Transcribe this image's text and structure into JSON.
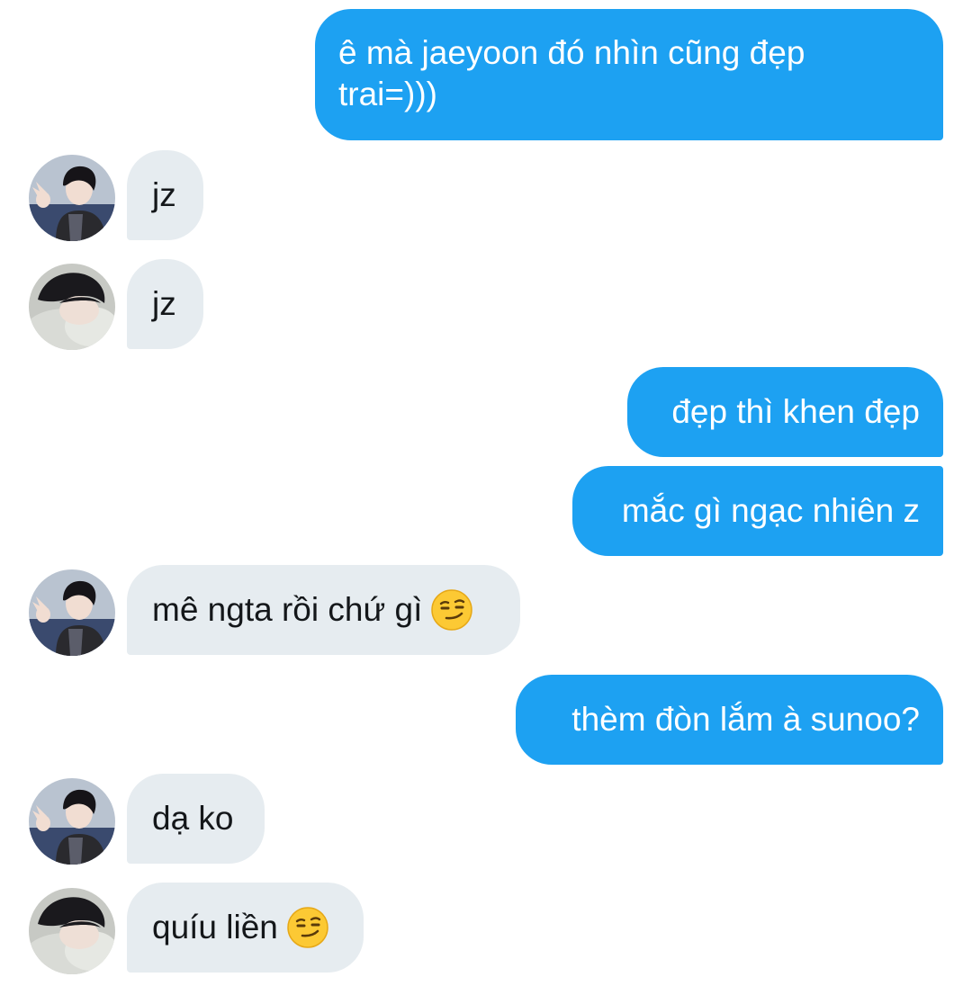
{
  "messages": [
    {
      "side": "out",
      "text": "ê mà jaeyoon đó nhìn cũng đẹp trai=)))"
    },
    {
      "side": "in",
      "sender": "avatar-a",
      "text": "jz"
    },
    {
      "side": "in",
      "sender": "avatar-b",
      "text": "jz"
    },
    {
      "side": "out",
      "text": "đẹp thì khen đẹp"
    },
    {
      "side": "out",
      "text": "mắc gì ngạc nhiên z"
    },
    {
      "side": "in",
      "sender": "avatar-a",
      "text": "mê ngta rồi chứ gì",
      "emoji": "smirking-face-emoji"
    },
    {
      "side": "out",
      "text": "thèm đòn lắm à sunoo?"
    },
    {
      "side": "in",
      "sender": "avatar-a",
      "text": "dạ ko"
    },
    {
      "side": "in",
      "sender": "avatar-b",
      "text": "quíu liền",
      "emoji": "smirking-face-emoji"
    }
  ],
  "colors": {
    "outgoing_bubble": "#1da1f2",
    "incoming_bubble": "#e6ecf0",
    "outgoing_text": "#ffffff",
    "incoming_text": "#14171a"
  }
}
